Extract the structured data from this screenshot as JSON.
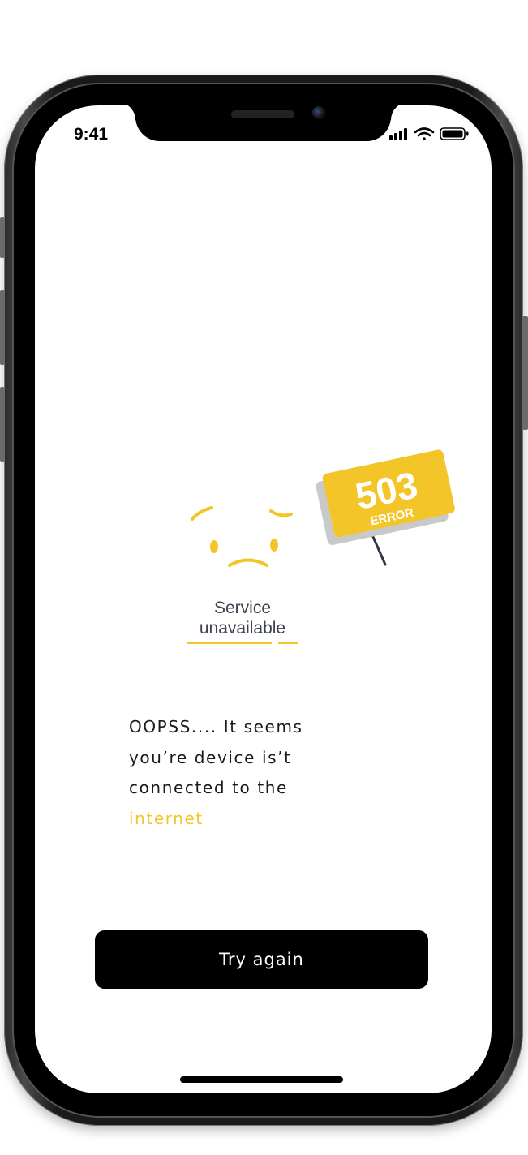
{
  "status_bar": {
    "time": "9:41",
    "icons": [
      "signal-icon",
      "wifi-icon",
      "battery-icon"
    ]
  },
  "illustration": {
    "sign_code": "503",
    "sign_label": "ERROR",
    "caption_line1": "Service",
    "caption_line2": "unavailable"
  },
  "message": {
    "line1": "OOPSS.... It seems",
    "line2": "you’re device is’t",
    "line3": "connected to the",
    "line4": "internet"
  },
  "button": {
    "label": "Try again"
  },
  "colors": {
    "accent": "#f4c529",
    "text": "#1a1a1a",
    "button_bg": "#000000",
    "button_text": "#ffffff"
  }
}
